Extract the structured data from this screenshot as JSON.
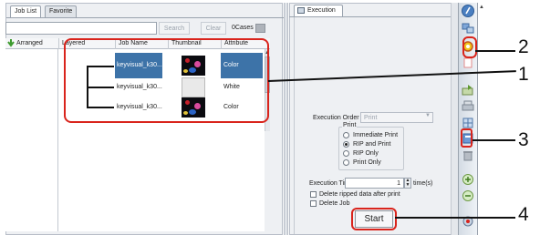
{
  "left_panel": {
    "tabs": [
      {
        "label": "Job List"
      },
      {
        "label": "Favorite"
      }
    ],
    "toolbar": {
      "search_value": "",
      "search_label": "Search",
      "clear_label": "Clear",
      "cases_text": "0Cases"
    },
    "list": {
      "arranged_label": "Arranged",
      "columns": [
        "Layered",
        "Job Name",
        "Thumbnail",
        "Attribute"
      ],
      "rows": [
        {
          "name": "keyvisual_k30...",
          "thumbnail": "color",
          "attribute": "Color",
          "selected": true
        },
        {
          "name": "keyvisual_k30...",
          "thumbnail": "white",
          "attribute": "White",
          "selected": false
        },
        {
          "name": "keyvisual_k30...",
          "thumbnail": "color",
          "attribute": "Color",
          "selected": false
        }
      ]
    }
  },
  "right_panel": {
    "tab_label": "Execution",
    "execution_order": {
      "label": "Execution Order",
      "value": "Print"
    },
    "print_group": {
      "label": "Print",
      "options": [
        "Immediate Print",
        "RIP and Print",
        "RIP Only",
        "Print Only"
      ],
      "selected": "RIP and Print"
    },
    "execution_times": {
      "label": "Execution Times",
      "value": "1",
      "unit": "time(s)"
    },
    "checkboxes": [
      {
        "label": "Delete ripped data after print",
        "checked": false
      },
      {
        "label": "Delete Job",
        "checked": false
      }
    ],
    "start_label": "Start"
  },
  "toolbar_icons": [
    "help-icon",
    "job-assistant-icon",
    "ink-settings-icon",
    "blank-icon",
    "export-icon",
    "printer-icon",
    "layout-icon",
    "execution-icon",
    "delete-icon",
    "zoom-in-icon",
    "zoom-out-icon",
    "more-icon"
  ],
  "callouts": [
    "1",
    "2",
    "3",
    "4"
  ],
  "colors": {
    "highlight": "#d9241c",
    "selection": "#3d73a8",
    "panel": "#eef0f3"
  }
}
